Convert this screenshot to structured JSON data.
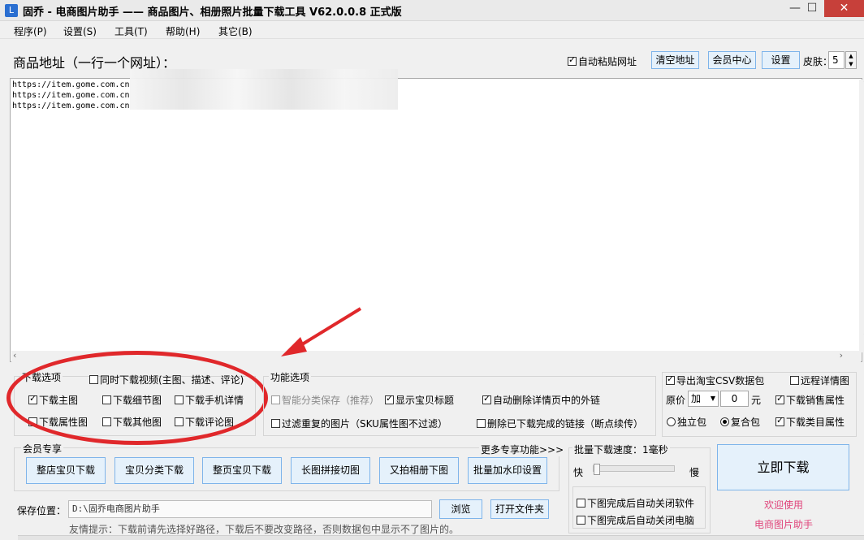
{
  "window": {
    "title": "固乔 - 电商图片助手 —— 商品图片、相册照片批量下载工具 V62.0.0.8 正式版",
    "min": "—",
    "max": "☐",
    "close": "✕"
  },
  "menu": [
    "程序(P)",
    "设置(S)",
    "工具(T)",
    "帮助(H)",
    "其它(B)"
  ],
  "header": {
    "label": "商品地址（一行一个网址）：",
    "auto_paste": {
      "label": "自动粘贴网址",
      "checked": true
    },
    "clear_btn": "清空地址",
    "member_btn": "会员中心",
    "settings_btn": "设置",
    "skin_label": "皮肤：",
    "skin_value": "5"
  },
  "urls": [
    "https://item.gome.com.cn",
    "https://item.gome.com.cn",
    "https://item.gome.com.cn"
  ],
  "download_options": {
    "title": "下载选项",
    "video": {
      "label": "同时下载视频(主图、描述、评论)",
      "checked": false
    },
    "main_image": {
      "label": "下载主图",
      "checked": true
    },
    "detail_image": {
      "label": "下载细节图",
      "checked": false
    },
    "mobile_detail": {
      "label": "下载手机详情",
      "checked": false
    },
    "attr_image": {
      "label": "下载属性图",
      "checked": false
    },
    "other_image": {
      "label": "下载其他图",
      "checked": false
    },
    "review_image": {
      "label": "下载评论图",
      "checked": false
    }
  },
  "feature_options": {
    "title": "功能选项",
    "smart_save": {
      "label": "智能分类保存（推荐）",
      "checked": false
    },
    "show_title": {
      "label": "显示宝贝标题",
      "checked": true
    },
    "auto_delete_links": {
      "label": "自动删除详情页中的外链",
      "checked": true
    },
    "filter_dup": {
      "label": "过滤重复的图片（SKU属性图不过滤）",
      "checked": false
    },
    "delete_done": {
      "label": "删除已下载完成的链接（断点续传）",
      "checked": false
    }
  },
  "export": {
    "csv": {
      "label": "导出淘宝CSV数据包",
      "checked": true
    },
    "remote_detail": {
      "label": "远程详情图",
      "checked": false
    },
    "price_label": "原价",
    "price_op": "加",
    "price_value": "0",
    "price_unit": "元",
    "sales_attr": {
      "label": "下载销售属性",
      "checked": true
    },
    "standalone": {
      "label": "独立包",
      "selected": false
    },
    "composite": {
      "label": "复合包",
      "selected": true
    },
    "category_attr": {
      "label": "下载类目属性",
      "checked": true
    }
  },
  "member": {
    "title": "会员专享",
    "more": "更多专享功能>>>",
    "buttons": [
      "整店宝贝下载",
      "宝贝分类下载",
      "整页宝贝下载",
      "长图拼接切图",
      "又拍相册下图",
      "批量加水印设置"
    ]
  },
  "speed": {
    "label": "批量下载速度：1毫秒",
    "fast": "快",
    "slow": "慢",
    "level": 0,
    "close_app": {
      "label": "下图完成后自动关闭软件",
      "checked": false
    },
    "shutdown": {
      "label": "下图完成后自动关闭电脑",
      "checked": false
    }
  },
  "download_now": "立即下载",
  "welcome": [
    "欢迎使用",
    "电商图片助手"
  ],
  "save": {
    "label": "保存位置：",
    "path": "D:\\固乔电商图片助手",
    "browse": "浏览",
    "open_folder": "打开文件夹",
    "hint": "友情提示：下载前请先选择好路径，下载后不要改变路径，否则数据包中显示不了图片的。"
  },
  "colors": {
    "annotation_red": "#e0282b",
    "welcome_pink": "#e0457b"
  }
}
